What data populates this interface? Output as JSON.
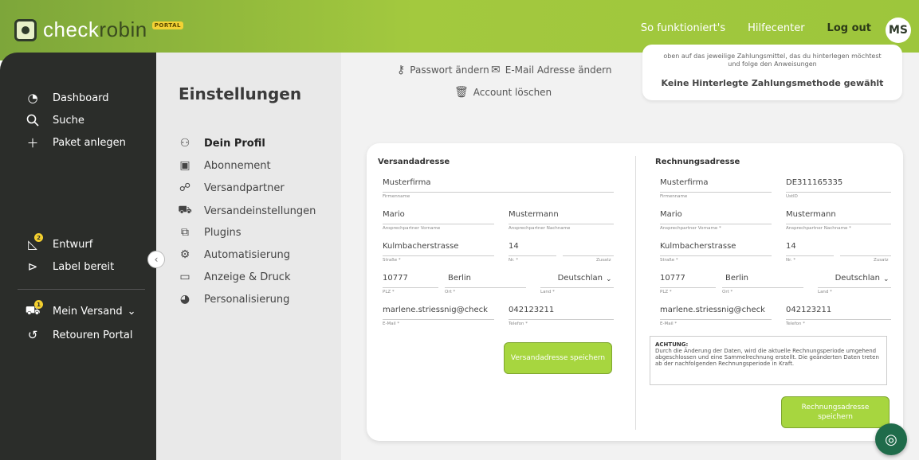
{
  "app": {
    "logo_check": "check",
    "logo_robin": "robin",
    "portal_badge": "PORTAL"
  },
  "topnav": {
    "how_it_works": "So funktioniert's",
    "help_center": "Hilfecenter",
    "logout": "Log out",
    "avatar_initials": "MS"
  },
  "sidebar": {
    "items": [
      {
        "label": "Dashboard",
        "icon": "gauge-icon"
      },
      {
        "label": "Suche",
        "icon": "search-icon"
      },
      {
        "label": "Paket anlegen",
        "icon": "plus-icon"
      },
      {
        "label": "Entwurf",
        "icon": "draft-icon",
        "badge": "2"
      },
      {
        "label": "Label bereit",
        "icon": "label-icon"
      },
      {
        "label": "Mein Versand",
        "icon": "truck-icon",
        "badge": "1"
      },
      {
        "label": "Retouren Portal",
        "icon": "return-icon"
      }
    ]
  },
  "settings": {
    "title": "Einstellungen",
    "items": [
      {
        "label": "Dein Profil",
        "icon": "people-icon"
      },
      {
        "label": "Abonnement",
        "icon": "card-icon"
      },
      {
        "label": "Versandpartner",
        "icon": "handshake-icon"
      },
      {
        "label": "Versandeinstellungen",
        "icon": "truck-icon"
      },
      {
        "label": "Plugins",
        "icon": "puzzle-icon"
      },
      {
        "label": "Automatisierung",
        "icon": "gears-icon"
      },
      {
        "label": "Anzeige & Druck",
        "icon": "monitor-icon"
      },
      {
        "label": "Personalisierung",
        "icon": "palette-icon"
      }
    ]
  },
  "security": {
    "change_password": "Passwort ändern",
    "change_email": "E-Mail Adresse ändern",
    "delete_account": "Account löschen"
  },
  "payment": {
    "hint_line1": "oben auf das jeweilige Zahlungsmittel, das du hinterlegen möchtest",
    "hint_line2": "und folge den Anweisungen",
    "none": "Keine Hinterlegte Zahlungsmethode gewählt"
  },
  "shipping": {
    "title": "Versandadresse",
    "company": {
      "value": "Musterfirma",
      "label": "Firmenname"
    },
    "first_name": {
      "value": "Mario",
      "label": "Ansprechpartner Vorname"
    },
    "last_name": {
      "value": "Mustermann",
      "label": "Ansprechpartner Nachname"
    },
    "street": {
      "value": "Kulmbacherstrasse",
      "label": "Straße *"
    },
    "number": {
      "value": "14",
      "label": "Nr. *"
    },
    "extra": {
      "value": "",
      "label": "Zusatz"
    },
    "zip": {
      "value": "10777",
      "label": "PLZ *"
    },
    "city": {
      "value": "Berlin",
      "label": "Ort *"
    },
    "country": {
      "value": "Deutschlan",
      "label": "Land *"
    },
    "email": {
      "value": "marlene.striessnig@check",
      "label": "E-Mail *"
    },
    "phone": {
      "value": "042123211",
      "label": "Telefon *"
    },
    "save": "Versandadresse speichern"
  },
  "billing": {
    "title": "Rechnungsadresse",
    "company": {
      "value": "Musterfirma",
      "label": "Firmenname"
    },
    "vat": {
      "value": "DE311165335",
      "label": "UstID"
    },
    "first_name": {
      "value": "Mario",
      "label": "Ansprechpartner Vorname *"
    },
    "last_name": {
      "value": "Mustermann",
      "label": "Ansprechpartner Nachname *"
    },
    "street": {
      "value": "Kulmbacherstrasse",
      "label": "Straße *"
    },
    "number": {
      "value": "14",
      "label": "Nr. *"
    },
    "extra": {
      "value": "",
      "label": "Zusatz"
    },
    "zip": {
      "value": "10777",
      "label": "PLZ *"
    },
    "city": {
      "value": "Berlin",
      "label": "Ort *"
    },
    "country": {
      "value": "Deutschlan",
      "label": "Land *"
    },
    "email": {
      "value": "marlene.striessnig@check",
      "label": "E-Mail *"
    },
    "phone": {
      "value": "042123211",
      "label": "Telefon *"
    },
    "notice_title": "ACHTUNG:",
    "notice_text": "Durch die Änderung der Daten, wird die aktuelle Rechnungsperiode umgehend abgeschlossen und eine Sammelrechnung erstellt. Die geänderten Daten treten ab der nachfolgenden Rechnungsperiode in Kraft.",
    "save": "Rechnungsadresse speichern"
  },
  "colors": {
    "brand_green": "#a3c93e",
    "sidebar_dark": "#2b2d2a",
    "button_green": "#a7d63f",
    "badge_yellow": "#f3cf2f",
    "chat_green": "#1f6b4a"
  }
}
